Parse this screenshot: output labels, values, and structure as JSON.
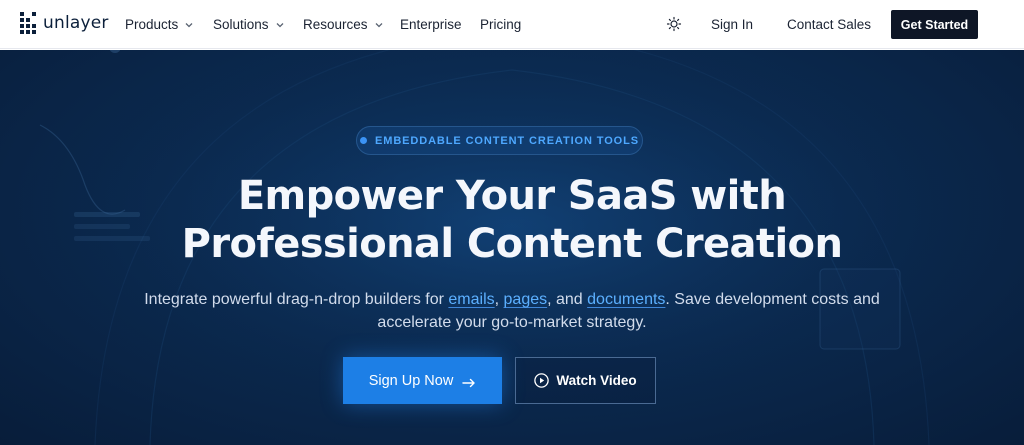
{
  "brand": {
    "name": "unlayer"
  },
  "nav": {
    "items": [
      {
        "label": "Products",
        "has_dropdown": true
      },
      {
        "label": "Solutions",
        "has_dropdown": true
      },
      {
        "label": "Resources",
        "has_dropdown": true
      },
      {
        "label": "Enterprise",
        "has_dropdown": false
      },
      {
        "label": "Pricing",
        "has_dropdown": false
      }
    ],
    "theme_toggle_icon": "sun-icon",
    "sign_in": "Sign In",
    "contact_sales": "Contact Sales",
    "get_started": "Get Started"
  },
  "hero": {
    "badge": "EMBEDDABLE CONTENT CREATION TOOLS",
    "headline_line1": "Empower Your SaaS with",
    "headline_line2": "Professional Content Creation",
    "subtext": {
      "part1": "Integrate powerful drag-n-drop builders for ",
      "link_emails": "emails",
      "sep1": ", ",
      "link_pages": "pages",
      "sep2": ", and ",
      "link_documents": "documents",
      "part2": ". Save development costs and accelerate your go-to-market strategy."
    },
    "primary_cta": "Sign Up Now",
    "primary_cta_icon": "arrow-right-icon",
    "secondary_cta": "Watch Video",
    "secondary_cta_icon": "play-circle-icon"
  },
  "colors": {
    "hero_bg": "#0b2a50",
    "accent": "#1d7fe6",
    "link": "#5cb0ff",
    "nav_cta_bg": "#0e1626"
  }
}
